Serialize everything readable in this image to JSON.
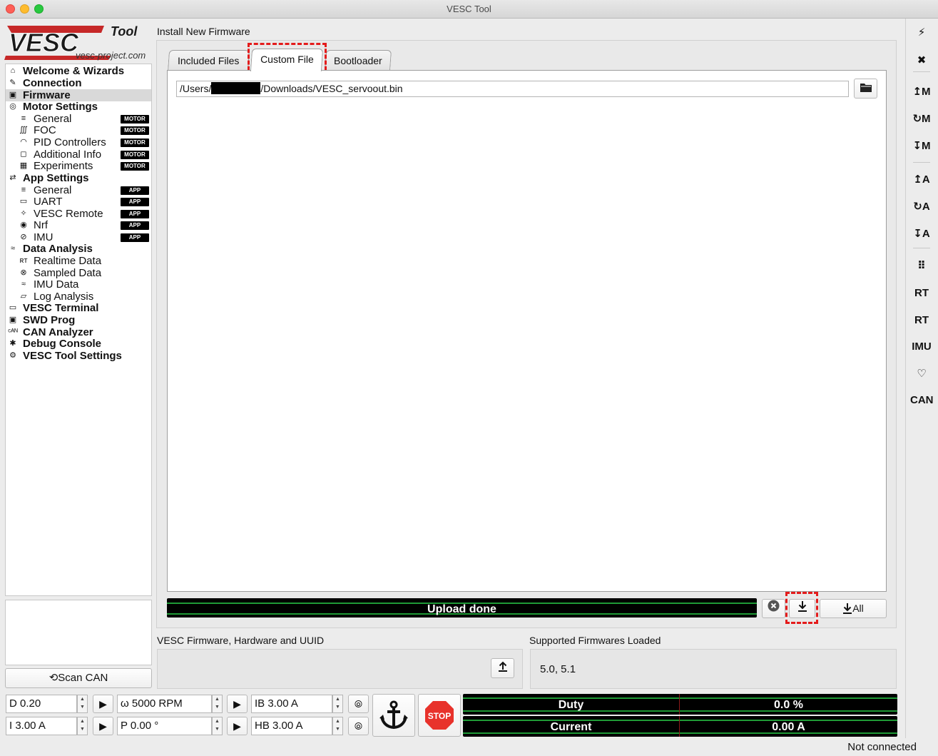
{
  "window": {
    "title": "VESC Tool"
  },
  "logo": {
    "brand": "VESC",
    "tool": "Tool",
    "site": "vesc-project.com"
  },
  "nav": [
    {
      "label": "Welcome & Wizards",
      "level": "top",
      "icon": "home-icon",
      "glyph": "⌂"
    },
    {
      "label": "Connection",
      "level": "top",
      "icon": "plug-icon",
      "glyph": "✎"
    },
    {
      "label": "Firmware",
      "level": "top",
      "icon": "chip-icon",
      "glyph": "▣",
      "selected": true
    },
    {
      "label": "Motor Settings",
      "level": "top",
      "icon": "motor-icon",
      "glyph": "◎"
    },
    {
      "label": "General",
      "level": "sub",
      "icon": "sliders-icon",
      "glyph": "≡",
      "badge": "MOTOR"
    },
    {
      "label": "FOC",
      "level": "sub",
      "icon": "coil-icon",
      "glyph": "∭",
      "badge": "MOTOR"
    },
    {
      "label": "PID Controllers",
      "level": "sub",
      "icon": "gauge-icon",
      "glyph": "◠",
      "badge": "MOTOR"
    },
    {
      "label": "Additional Info",
      "level": "sub",
      "icon": "comment-icon",
      "glyph": "◻",
      "badge": "MOTOR"
    },
    {
      "label": "Experiments",
      "level": "sub",
      "icon": "calculator-icon",
      "glyph": "▦",
      "badge": "MOTOR"
    },
    {
      "label": "App Settings",
      "level": "top",
      "icon": "arrows-icon",
      "glyph": "⇄"
    },
    {
      "label": "General",
      "level": "sub",
      "icon": "sliders-icon",
      "glyph": "≡",
      "badge": "APP"
    },
    {
      "label": "UART",
      "level": "sub",
      "icon": "keyboard-icon",
      "glyph": "▭",
      "badge": "APP"
    },
    {
      "label": "VESC Remote",
      "level": "sub",
      "icon": "remote-icon",
      "glyph": "✧",
      "badge": "APP"
    },
    {
      "label": "Nrf",
      "level": "sub",
      "icon": "wireless-icon",
      "glyph": "◉",
      "badge": "APP"
    },
    {
      "label": "IMU",
      "level": "sub",
      "icon": "imu-icon",
      "glyph": "⊘",
      "badge": "APP"
    },
    {
      "label": "Data Analysis",
      "level": "top",
      "icon": "chart-icon",
      "glyph": "≈"
    },
    {
      "label": "Realtime Data",
      "level": "sub",
      "icon": "rt-icon",
      "glyph": "ʀᴛ"
    },
    {
      "label": "Sampled Data",
      "level": "sub",
      "icon": "sample-icon",
      "glyph": "⊗"
    },
    {
      "label": "IMU Data",
      "level": "sub",
      "icon": "imu-data-icon",
      "glyph": "≈"
    },
    {
      "label": "Log Analysis",
      "level": "sub",
      "icon": "map-icon",
      "glyph": "▱"
    },
    {
      "label": "VESC Terminal",
      "level": "top",
      "icon": "terminal-icon",
      "glyph": "▭"
    },
    {
      "label": "SWD Prog",
      "level": "top",
      "icon": "swd-icon",
      "glyph": "▣"
    },
    {
      "label": "CAN Analyzer",
      "level": "top",
      "icon": "can-icon",
      "glyph": "ᶜᴬᴺ"
    },
    {
      "label": "Debug Console",
      "level": "top",
      "icon": "bug-icon",
      "glyph": "✱"
    },
    {
      "label": "VESC Tool Settings",
      "level": "top",
      "icon": "gear-icon",
      "glyph": "⚙"
    }
  ],
  "scan_can": "Scan CAN",
  "page": {
    "title": "Install New Firmware",
    "tabs": [
      "Included Files",
      "Custom File",
      "Bootloader"
    ],
    "active_tab": "Custom File",
    "path_prefix": "/Users/",
    "path_suffix": "/Downloads/VESC_servoout.bin",
    "progress_label": "Upload done",
    "upload_all": "All",
    "fw_hw_label": "VESC Firmware, Hardware and UUID",
    "supported_label": "Supported Firmwares Loaded",
    "supported_value": "5.0, 5.1"
  },
  "controls": {
    "duty": "D 0.20",
    "current": "I 3.00 A",
    "rpm": "ω 5000 RPM",
    "position": "P 0.00 °",
    "brake": "IB 3.00 A",
    "handbrake": "HB 3.00 A",
    "stop": "STOP"
  },
  "gauges": {
    "duty_label": "Duty",
    "duty_value": "0.0 %",
    "current_label": "Current",
    "current_value": "0.00 A"
  },
  "status": "Not connected",
  "right_toolbar": [
    {
      "name": "connect-icon",
      "glyph": "⚡"
    },
    {
      "name": "disconnect-icon",
      "glyph": "✖"
    },
    {
      "name": "read-motor-config-icon",
      "glyph": "↥M"
    },
    {
      "name": "read-default-motor-config-icon",
      "glyph": "↻M"
    },
    {
      "name": "write-motor-config-icon",
      "glyph": "↧M"
    },
    {
      "name": "read-app-config-icon",
      "glyph": "↥A"
    },
    {
      "name": "read-default-app-config-icon",
      "glyph": "↻A"
    },
    {
      "name": "write-app-config-icon",
      "glyph": "↧A"
    },
    {
      "name": "can-fwd-icon",
      "glyph": "⠿"
    },
    {
      "name": "rt-data-icon",
      "glyph": "RT"
    },
    {
      "name": "rt-app-icon",
      "glyph": "RT"
    },
    {
      "name": "imu-stream-icon",
      "glyph": "IMU"
    },
    {
      "name": "heart-icon",
      "glyph": "♡"
    },
    {
      "name": "can-scan-icon",
      "glyph": "CAN"
    }
  ],
  "colors": {
    "annotation": "#e41b1b",
    "bar_green": "#1f9a36",
    "stop_red": "#e8322b"
  }
}
